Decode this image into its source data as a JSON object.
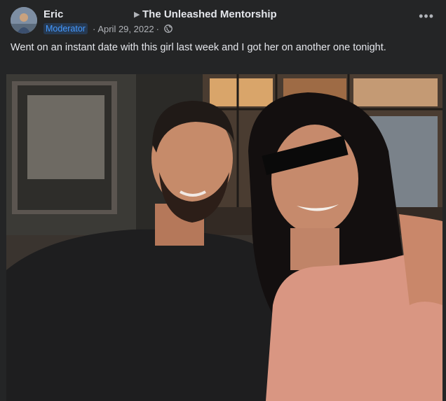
{
  "post": {
    "author": "Eric",
    "group_arrow_icon": "triangle-right-icon",
    "group_name": "The Unleashed Mentorship",
    "badge": "Moderator",
    "date": "April 29, 2022",
    "separator": "·",
    "privacy_icon": "globe-icon",
    "more_icon": "more-options-icon",
    "more_label": "•••",
    "text": "Went on an instant date with this girl last week and I got her on another one tonight.",
    "photo_alt": "Photo of a man and a woman seated together, the woman's eyes covered by a black bar"
  }
}
